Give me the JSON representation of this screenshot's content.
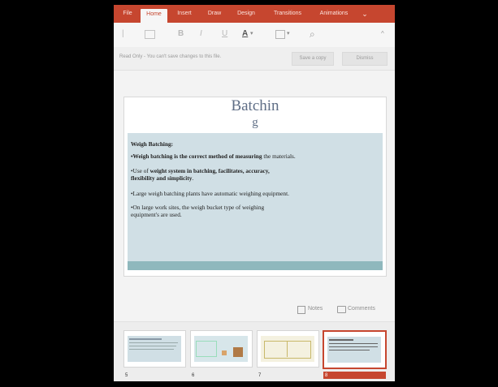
{
  "ribbon": {
    "tabs": [
      "File",
      "Home",
      "Insert",
      "Draw",
      "Design",
      "Transitions",
      "Animations"
    ],
    "active_tab": "Home",
    "more_glyph": "⌄"
  },
  "toolbar": {
    "bold": "B",
    "italic": "I",
    "underline": "U",
    "font_color": "A",
    "search_glyph": "⌕",
    "collapse_glyph": "^"
  },
  "infobar": {
    "message": "Read Only - You can't save changes to this file.",
    "save_copy_label": "Save a copy",
    "dismiss_label": "Dismiss"
  },
  "slide": {
    "title_line1": "Batchin",
    "title_line2": "g",
    "heading": "Weigh Batching:",
    "b1_bold": "•Weigh batching is the correct method of measuring",
    "b1_rest": " the materials.",
    "b2_a": "•Use  of ",
    "b2_bold1": "weight  system  in  batching,  facilitates,  accuracy,",
    "b2_bold2": "flexibility and simplicity",
    "b2_end": ".",
    "b3": "•Large weigh batching plants have     automatic weighing equipment.",
    "b4_line1": "•On large      work  sites,  the  weigh  bucket  type  of  weighing",
    "b4_line2": "equipment's are used."
  },
  "notesbar": {
    "notes_label": "Notes",
    "comments_label": "Comments"
  },
  "thumbnails": {
    "numbers": [
      "5",
      "6",
      "7",
      "8"
    ],
    "selected_index": 3
  },
  "colors": {
    "ribbon": "#c6462f",
    "slide_body": "#d0dfe5",
    "strip": "#8fb8bd",
    "title": "#5f6e86"
  }
}
